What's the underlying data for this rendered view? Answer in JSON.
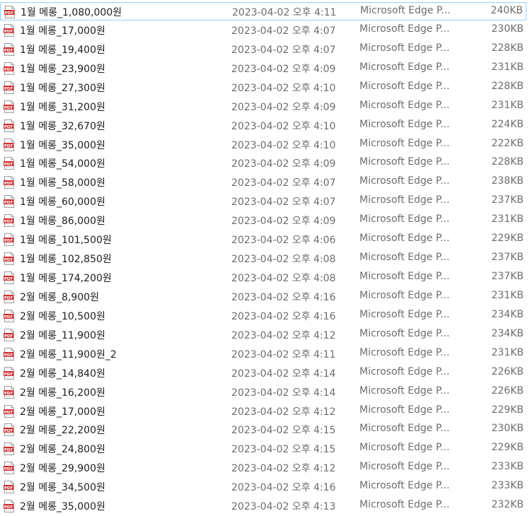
{
  "files": [
    {
      "name": "1월 메롱_1,080,000원",
      "date": "2023-04-02 오후 4:11",
      "type": "Microsoft Edge P...",
      "size": "240KB",
      "icon": "pdf-file-icon"
    },
    {
      "name": "1월 메롱_17,000원",
      "date": "2023-04-02 오후 4:07",
      "type": "Microsoft Edge P...",
      "size": "230KB",
      "icon": "pdf-file-icon"
    },
    {
      "name": "1월 메롱_19,400원",
      "date": "2023-04-02 오후 4:07",
      "type": "Microsoft Edge P...",
      "size": "228KB",
      "icon": "pdf-file-icon"
    },
    {
      "name": "1월 메롱_23,900원",
      "date": "2023-04-02 오후 4:09",
      "type": "Microsoft Edge P...",
      "size": "231KB",
      "icon": "pdf-file-icon"
    },
    {
      "name": "1월 메롱_27,300원",
      "date": "2023-04-02 오후 4:10",
      "type": "Microsoft Edge P...",
      "size": "228KB",
      "icon": "pdf-file-icon"
    },
    {
      "name": "1월 메롱_31,200원",
      "date": "2023-04-02 오후 4:09",
      "type": "Microsoft Edge P...",
      "size": "231KB",
      "icon": "pdf-file-icon"
    },
    {
      "name": "1월 메롱_32,670원",
      "date": "2023-04-02 오후 4:10",
      "type": "Microsoft Edge P...",
      "size": "224KB",
      "icon": "pdf-file-icon"
    },
    {
      "name": "1월 메롱_35,000원",
      "date": "2023-04-02 오후 4:10",
      "type": "Microsoft Edge P...",
      "size": "222KB",
      "icon": "pdf-file-icon"
    },
    {
      "name": "1월 메롱_54,000원",
      "date": "2023-04-02 오후 4:09",
      "type": "Microsoft Edge P...",
      "size": "228KB",
      "icon": "pdf-file-icon"
    },
    {
      "name": "1월 메롱_58,000원",
      "date": "2023-04-02 오후 4:07",
      "type": "Microsoft Edge P...",
      "size": "238KB",
      "icon": "pdf-file-icon"
    },
    {
      "name": "1월 메롱_60,000원",
      "date": "2023-04-02 오후 4:07",
      "type": "Microsoft Edge P...",
      "size": "237KB",
      "icon": "pdf-file-icon"
    },
    {
      "name": "1월 메롱_86,000원",
      "date": "2023-04-02 오후 4:09",
      "type": "Microsoft Edge P...",
      "size": "231KB",
      "icon": "pdf-file-icon"
    },
    {
      "name": "1월 메롱_101,500원",
      "date": "2023-04-02 오후 4:06",
      "type": "Microsoft Edge P...",
      "size": "229KB",
      "icon": "pdf-file-icon"
    },
    {
      "name": "1월 메롱_102,850원",
      "date": "2023-04-02 오후 4:08",
      "type": "Microsoft Edge P...",
      "size": "237KB",
      "icon": "pdf-file-icon"
    },
    {
      "name": "1월 메롱_174,200원",
      "date": "2023-04-02 오후 4:08",
      "type": "Microsoft Edge P...",
      "size": "237KB",
      "icon": "pdf-file-icon"
    },
    {
      "name": "2월 메롱_8,900원",
      "date": "2023-04-02 오후 4:16",
      "type": "Microsoft Edge P...",
      "size": "231KB",
      "icon": "pdf-file-icon"
    },
    {
      "name": "2월 메롱_10,500원",
      "date": "2023-04-02 오후 4:16",
      "type": "Microsoft Edge P...",
      "size": "234KB",
      "icon": "pdf-file-icon"
    },
    {
      "name": "2월 메롱_11,900원",
      "date": "2023-04-02 오후 4:12",
      "type": "Microsoft Edge P...",
      "size": "234KB",
      "icon": "pdf-file-icon"
    },
    {
      "name": "2월 메롱_11,900원_2",
      "date": "2023-04-02 오후 4:11",
      "type": "Microsoft Edge P...",
      "size": "231KB",
      "icon": "pdf-file-icon"
    },
    {
      "name": "2월 메롱_14,840원",
      "date": "2023-04-02 오후 4:14",
      "type": "Microsoft Edge P...",
      "size": "226KB",
      "icon": "pdf-file-icon"
    },
    {
      "name": "2월 메롱_16,200원",
      "date": "2023-04-02 오후 4:14",
      "type": "Microsoft Edge P...",
      "size": "226KB",
      "icon": "pdf-file-icon"
    },
    {
      "name": "2월 메롱_17,000원",
      "date": "2023-04-02 오후 4:12",
      "type": "Microsoft Edge P...",
      "size": "229KB",
      "icon": "pdf-file-icon"
    },
    {
      "name": "2월 메롱_22,200원",
      "date": "2023-04-02 오후 4:15",
      "type": "Microsoft Edge P...",
      "size": "230KB",
      "icon": "pdf-file-icon"
    },
    {
      "name": "2월 메롱_24,800원",
      "date": "2023-04-02 오후 4:15",
      "type": "Microsoft Edge P...",
      "size": "229KB",
      "icon": "pdf-file-icon"
    },
    {
      "name": "2월 메롱_29,900원",
      "date": "2023-04-02 오후 4:12",
      "type": "Microsoft Edge P...",
      "size": "233KB",
      "icon": "pdf-file-icon"
    },
    {
      "name": "2월 메롱_34,500원",
      "date": "2023-04-02 오후 4:16",
      "type": "Microsoft Edge P...",
      "size": "233KB",
      "icon": "pdf-file-icon"
    },
    {
      "name": "2월 메롱_35,000원",
      "date": "2023-04-02 오후 4:13",
      "type": "Microsoft Edge P...",
      "size": "232KB",
      "icon": "pdf-file-icon"
    }
  ],
  "selected_index": 0,
  "colors": {
    "selection_border": "#99d1ff",
    "name_text": "#1e1e1e",
    "detail_text": "#6d6d6d",
    "pdf_icon_red": "#d32f2f"
  }
}
